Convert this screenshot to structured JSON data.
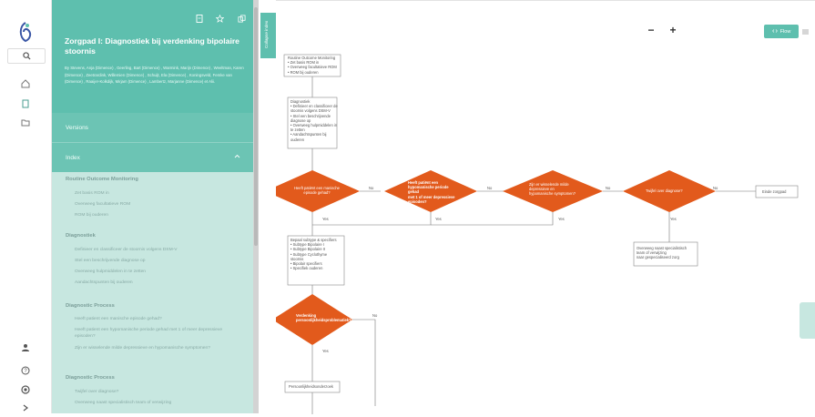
{
  "panel": {
    "title": "Zorgpad I: Diagnostiek bij verdenking bipolaire stoornis",
    "authors": "By Stevens, Anja (Dimence) , Geerling, Bart (Dimence) , Warmink, Marijn (Dimence) , Weeltman, Karen (Dimence) , Zeetrardink, Willemien (Dimence) , Schuijt, Ela (Dimence) , Koningsveld, Femke van (Dimence) , Raaijer-Kolkdijk, Mirjam (Dimence) , Lambertz, Marjanne (Dimence) et Alii.",
    "versions_label": "Versions",
    "index_label": "Index",
    "sections": [
      {
        "title": "Routine Outcome Monitoring",
        "items": [
          "Zet basis ROM in",
          "Overweeg facultatieve ROM",
          "ROM bij ouderen"
        ]
      },
      {
        "title": "Diagnostiek",
        "items": [
          "Definieer en classificeer de stoornis volgens DSM-V",
          "Stel een beschrijvende diagnose op",
          "Overweeg hulpmiddelen in te zetten",
          "Aandachtspunten bij ouderen"
        ]
      },
      {
        "title": "Diagnostic Process",
        "items": [
          "Heeft patient een manische episode gehad?",
          "Heeft patient een hypomanische periode gehad met 1 of meer depressieve episoden?",
          "Zijn er wisselende milde depressieve en hypomanische symptomen?"
        ]
      },
      {
        "title": "Diagnostic Process",
        "items": [
          "Twijfel over diagnose?",
          "Overweeg naast specialistisch team of verwijzing"
        ]
      }
    ]
  },
  "collapse_label": "Collapse index",
  "toolbar": {
    "zoom_out": "−",
    "zoom_in": "+",
    "flow_label": "Flow"
  },
  "flow": {
    "box1": [
      "Routine Outcome Monitoring",
      "• Zet basis ROM in",
      "• Overweeg facultatieve ROM",
      "• ROM bij ouderen"
    ],
    "box2": [
      "Diagnostiek",
      "• Definieer en classificeer de",
      "stoornis volgens DSM-V",
      "• Stel een beschrijvende",
      "diagnose op",
      "• Overweeg hulpmiddelen in",
      "te zetten",
      "• Aandachtspunten bij",
      "ouderen"
    ],
    "d1": [
      "Heeft patiënt een manische",
      "episode gehad?"
    ],
    "d2": [
      "Heeft patiënt een",
      "hypomanische periode gehad",
      "met 1 of meer depressieve",
      "episoden?"
    ],
    "d3": [
      "Zijn er wisselende milde",
      "depressieve en",
      "hypomanische symptomen?"
    ],
    "d4": [
      "Twijfel over diagnose?"
    ],
    "d5": [
      "Verdenking",
      "persoonlijkheidsproblematiek?"
    ],
    "end_box": "Einde zorgpad",
    "box_specify": [
      "Bepaal subtype & specifiers",
      "• Subtype Bipolaire I",
      "• Subtype Bipolaire II",
      "• Subtype Cyclothyme",
      "stoornis",
      "• Bipolair specifiers",
      "• Specifiek ouderen"
    ],
    "box_refer": [
      "Overweeg naast specialistisch",
      "team of verwijzing",
      "naar gespecialiseerd zorg"
    ],
    "box_personality": "Persoonlijkheidsonderzoek",
    "yes": "Yes",
    "no": "No"
  },
  "colors": {
    "accent": "#5ebfae",
    "panel_bg": "#c7e7e0",
    "diamond": "#e25a1c"
  }
}
